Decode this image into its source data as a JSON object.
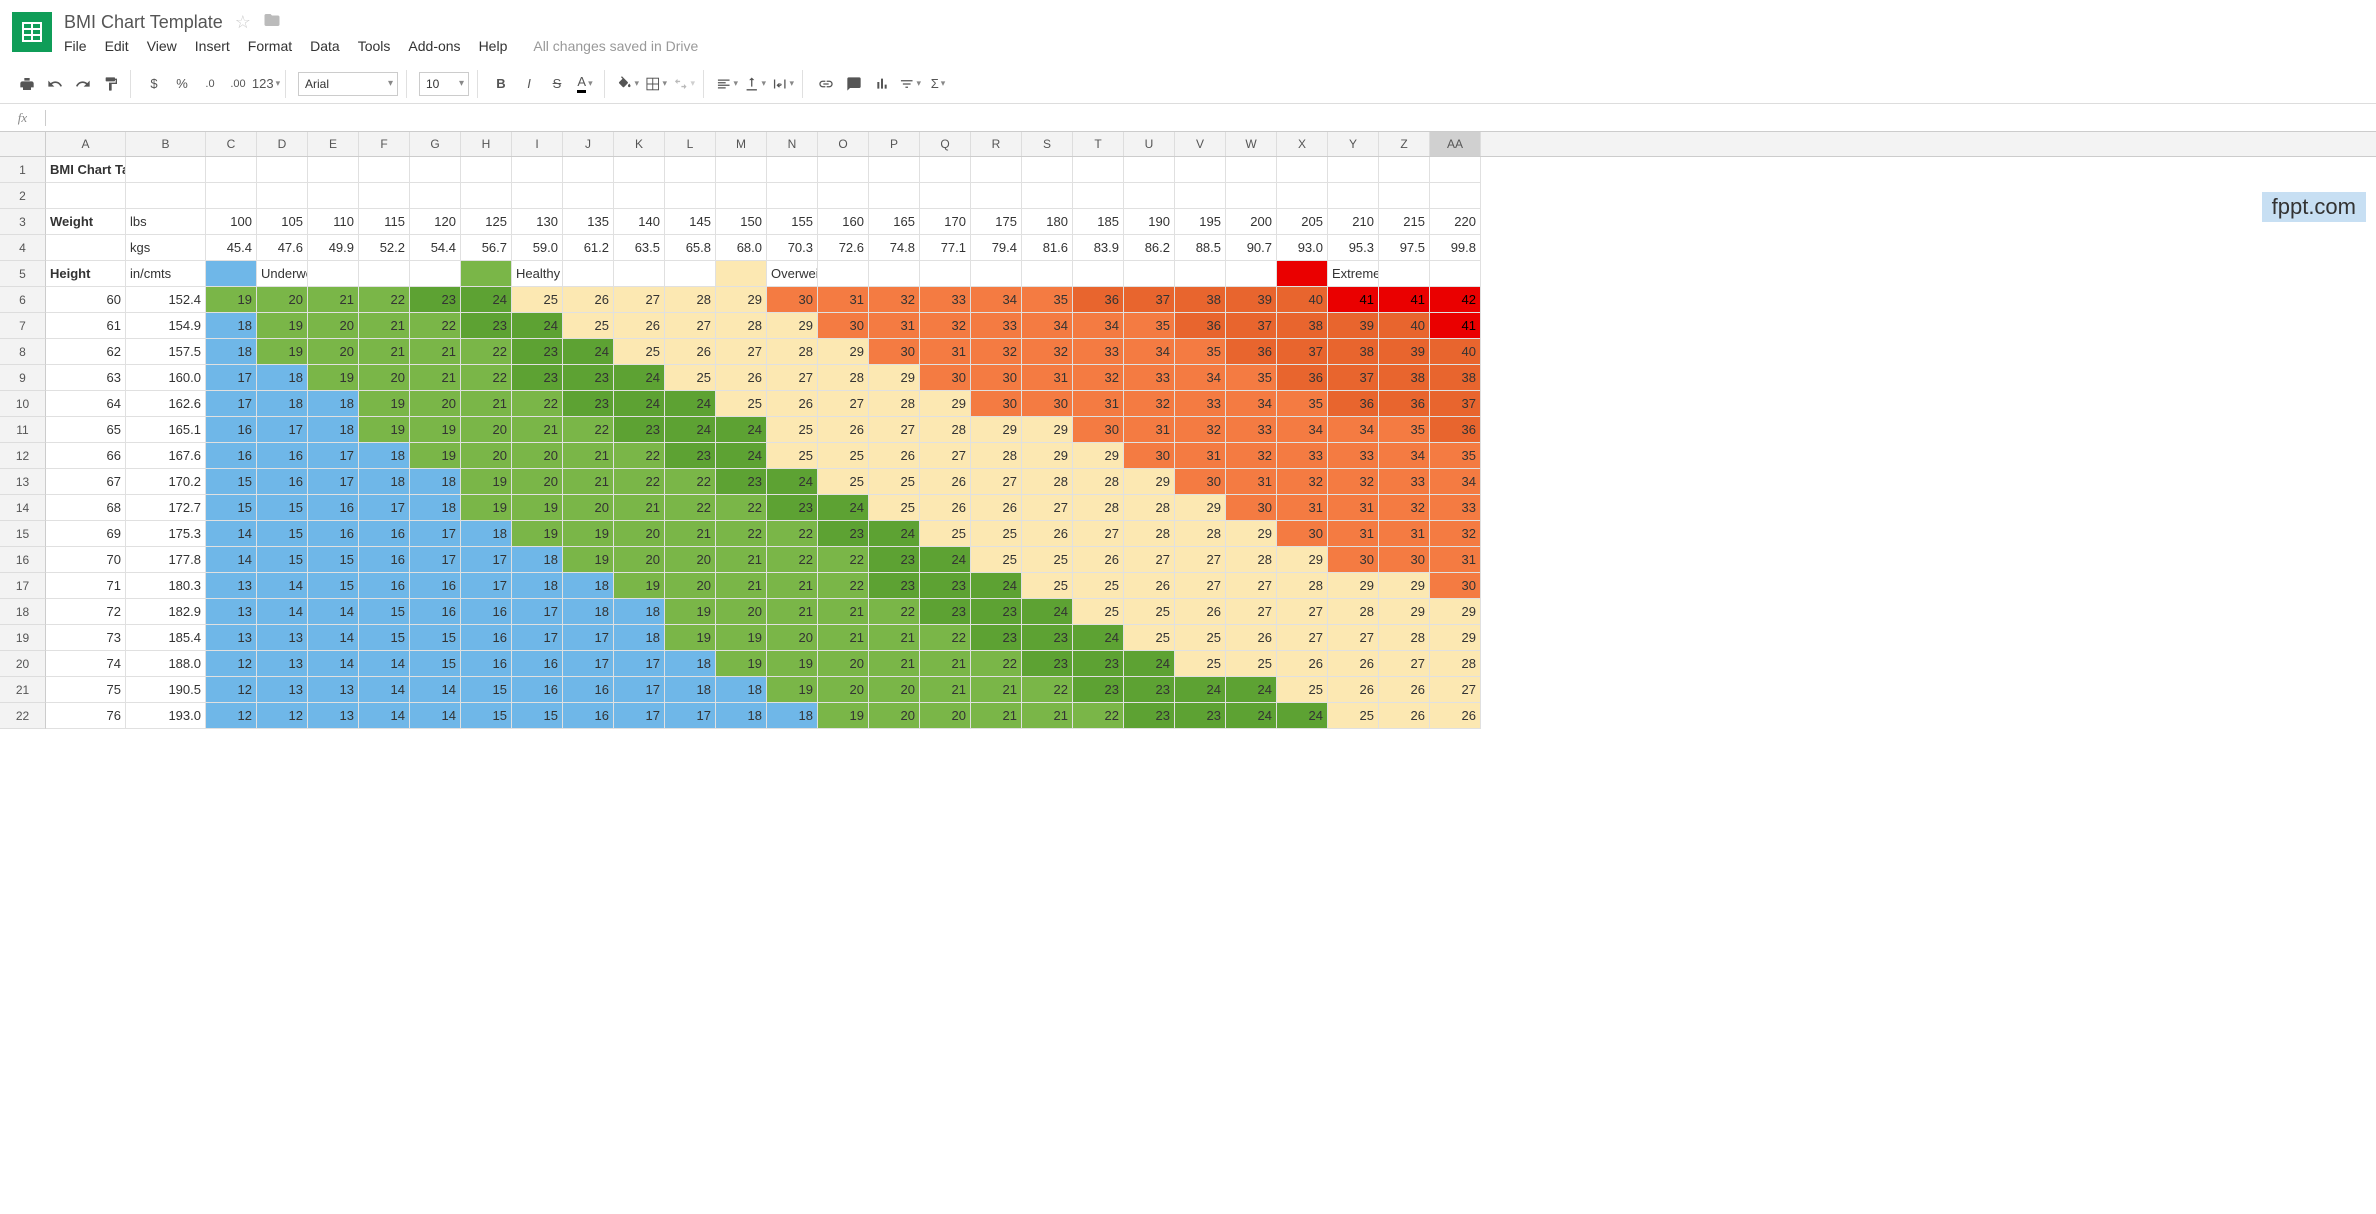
{
  "doc_title": "BMI Chart Template",
  "menu": [
    "File",
    "Edit",
    "View",
    "Insert",
    "Format",
    "Data",
    "Tools",
    "Add-ons",
    "Help"
  ],
  "save_status": "All changes saved in Drive",
  "font_name": "Arial",
  "font_size": "10",
  "fx": "fx",
  "watermark": "fppt.com",
  "columns": [
    "A",
    "B",
    "C",
    "D",
    "E",
    "F",
    "G",
    "H",
    "I",
    "J",
    "K",
    "L",
    "M",
    "N",
    "O",
    "P",
    "Q",
    "R",
    "S",
    "T",
    "U",
    "V",
    "W",
    "X",
    "Y",
    "Z",
    "AA"
  ],
  "col_widths": {
    "A": 80,
    "B": 80,
    "rest": 51
  },
  "row1": {
    "title": "BMI Chart Table"
  },
  "row3": {
    "label": "Weight",
    "unit": "lbs",
    "vals": [
      100,
      105,
      110,
      115,
      120,
      125,
      130,
      135,
      140,
      145,
      150,
      155,
      160,
      165,
      170,
      175,
      180,
      185,
      190,
      195,
      200,
      205,
      210,
      215,
      220
    ]
  },
  "row4": {
    "unit": "kgs",
    "vals": [
      45.4,
      47.6,
      49.9,
      52.2,
      54.4,
      56.7,
      59.0,
      61.2,
      63.5,
      65.8,
      68.0,
      70.3,
      72.6,
      74.8,
      77.1,
      79.4,
      81.6,
      83.9,
      86.2,
      88.5,
      90.7,
      93.0,
      95.3,
      97.5,
      99.8
    ]
  },
  "row5": {
    "label": "Height",
    "unit": "in/cmts",
    "legend": {
      "under": "Underweight",
      "healthy": "Healthy",
      "over": "Overweight",
      "obese": "Extremely Obese"
    }
  },
  "heights_in": [
    60,
    61,
    62,
    63,
    64,
    65,
    66,
    67,
    68,
    69,
    70,
    71,
    72,
    73,
    74,
    75,
    76
  ],
  "heights_cm": [
    152.4,
    154.9,
    157.5,
    160.0,
    162.6,
    165.1,
    167.6,
    170.2,
    172.7,
    175.3,
    177.8,
    180.3,
    182.9,
    185.4,
    188.0,
    190.5,
    193.0
  ],
  "bmi": [
    [
      19,
      20,
      21,
      22,
      23,
      24,
      25,
      26,
      27,
      28,
      29,
      30,
      31,
      32,
      33,
      34,
      35,
      36,
      37,
      38,
      39,
      40,
      41,
      41,
      42
    ],
    [
      18,
      19,
      20,
      21,
      22,
      23,
      24,
      25,
      26,
      27,
      28,
      29,
      30,
      31,
      32,
      33,
      34,
      34,
      35,
      36,
      37,
      38,
      39,
      40,
      41
    ],
    [
      18,
      19,
      20,
      21,
      21,
      22,
      23,
      24,
      25,
      26,
      27,
      28,
      29,
      30,
      31,
      32,
      32,
      33,
      34,
      35,
      36,
      37,
      38,
      39,
      40
    ],
    [
      17,
      18,
      19,
      20,
      21,
      22,
      23,
      23,
      24,
      25,
      26,
      27,
      28,
      29,
      30,
      30,
      31,
      32,
      33,
      34,
      35,
      36,
      37,
      38,
      38
    ],
    [
      17,
      18,
      18,
      19,
      20,
      21,
      22,
      23,
      24,
      24,
      25,
      26,
      27,
      28,
      29,
      30,
      30,
      31,
      32,
      33,
      34,
      35,
      36,
      36,
      37
    ],
    [
      16,
      17,
      18,
      19,
      19,
      20,
      21,
      22,
      23,
      24,
      24,
      25,
      26,
      27,
      28,
      29,
      29,
      30,
      31,
      32,
      33,
      34,
      34,
      35,
      36
    ],
    [
      16,
      16,
      17,
      18,
      19,
      20,
      20,
      21,
      22,
      23,
      24,
      25,
      25,
      26,
      27,
      28,
      29,
      29,
      30,
      31,
      32,
      33,
      33,
      34,
      35
    ],
    [
      15,
      16,
      17,
      18,
      18,
      19,
      20,
      21,
      22,
      22,
      23,
      24,
      25,
      25,
      26,
      27,
      28,
      28,
      29,
      30,
      31,
      32,
      32,
      33,
      34
    ],
    [
      15,
      15,
      16,
      17,
      18,
      19,
      19,
      20,
      21,
      22,
      22,
      23,
      24,
      25,
      26,
      26,
      27,
      28,
      28,
      29,
      30,
      31,
      31,
      32,
      33
    ],
    [
      14,
      15,
      16,
      16,
      17,
      18,
      19,
      19,
      20,
      21,
      22,
      22,
      23,
      24,
      25,
      25,
      26,
      27,
      28,
      28,
      29,
      30,
      31,
      31,
      32
    ],
    [
      14,
      15,
      15,
      16,
      17,
      17,
      18,
      19,
      20,
      20,
      21,
      22,
      22,
      23,
      24,
      25,
      25,
      26,
      27,
      27,
      28,
      29,
      30,
      30,
      31
    ],
    [
      13,
      14,
      15,
      16,
      16,
      17,
      18,
      18,
      19,
      20,
      21,
      21,
      22,
      23,
      23,
      24,
      25,
      25,
      26,
      27,
      27,
      28,
      29,
      29,
      30
    ],
    [
      13,
      14,
      14,
      15,
      16,
      16,
      17,
      18,
      18,
      19,
      20,
      21,
      21,
      22,
      23,
      23,
      24,
      25,
      25,
      26,
      27,
      27,
      28,
      29,
      29
    ],
    [
      13,
      13,
      14,
      15,
      15,
      16,
      17,
      17,
      18,
      19,
      19,
      20,
      21,
      21,
      22,
      23,
      23,
      24,
      25,
      25,
      26,
      27,
      27,
      28,
      29
    ],
    [
      12,
      13,
      14,
      14,
      15,
      16,
      16,
      17,
      17,
      18,
      19,
      19,
      20,
      21,
      21,
      22,
      23,
      23,
      24,
      25,
      25,
      26,
      26,
      27,
      28
    ],
    [
      12,
      13,
      13,
      14,
      14,
      15,
      16,
      16,
      17,
      18,
      18,
      19,
      20,
      20,
      21,
      21,
      22,
      23,
      23,
      24,
      24,
      25,
      26,
      26,
      27
    ],
    [
      12,
      12,
      13,
      14,
      14,
      15,
      15,
      16,
      17,
      17,
      18,
      18,
      19,
      20,
      20,
      21,
      21,
      22,
      23,
      23,
      24,
      24,
      25,
      26,
      26
    ]
  ]
}
